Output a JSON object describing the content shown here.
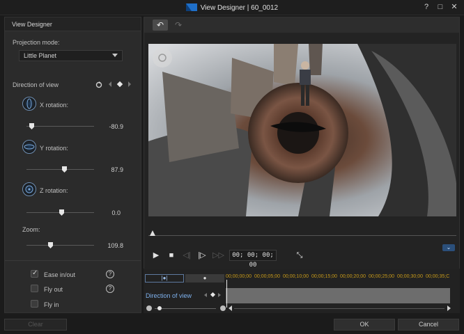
{
  "window": {
    "title": "View Designer  |  60_0012",
    "help": "?",
    "maximize": "□",
    "close": "✕"
  },
  "left_panel": {
    "header": "View Designer",
    "projection_label": "Projection mode:",
    "projection_value": "Little Planet",
    "direction_label": "Direction of view",
    "x_rotation": {
      "label": "X rotation:",
      "value": "-80.9"
    },
    "y_rotation": {
      "label": "Y rotation:",
      "value": "87.9"
    },
    "z_rotation": {
      "label": "Z rotation:",
      "value": "0.0"
    },
    "zoom": {
      "label": "Zoom:",
      "value": "109.8"
    },
    "ease": {
      "label": "Ease in/out",
      "checked": true
    },
    "fly_out": {
      "label": "Fly out",
      "checked": false
    },
    "fly_in": {
      "label": "Fly in",
      "checked": false
    },
    "help_glyph": "?"
  },
  "toolbar": {
    "undo": "↶",
    "redo": "↷"
  },
  "player": {
    "timecode": "00; 00; 00; 00",
    "play": "▶",
    "stop": "■",
    "prev_frame": "◁|",
    "next_frame": "|▷",
    "fast_forward": "▷▷",
    "fullscreen": "⤡",
    "collapse": "⌄"
  },
  "timeline": {
    "tab1": "|●|",
    "tab2": "●",
    "track_label": "Direction of view",
    "ruler": [
      "00;00;00;00",
      "00;00;05;00",
      "00;00;10;00",
      "00;00;15;00",
      "00;00;20;00",
      "00;00;25;00",
      "00;00;30;00",
      "00;00;35;C"
    ]
  },
  "footer": {
    "clear": "Clear",
    "ok": "OK",
    "cancel": "Cancel"
  }
}
